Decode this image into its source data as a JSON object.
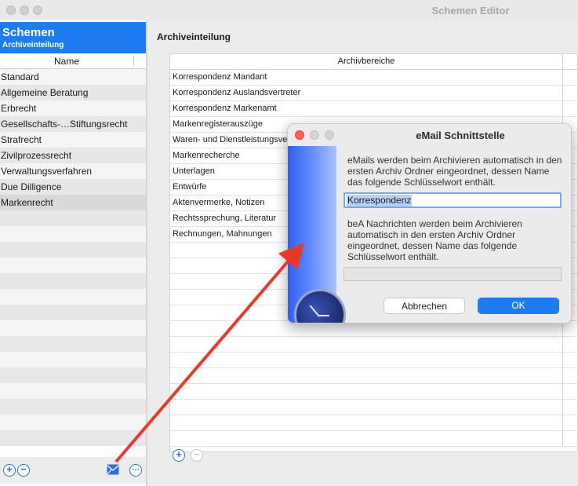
{
  "window": {
    "title": "Schemen Editor"
  },
  "left": {
    "title": "Schemen",
    "subtitle": "Archiveinteilung",
    "column_header": "Name",
    "items": [
      "Standard",
      "Allgemeine Beratung",
      "Erbrecht",
      "Gesellschafts-…Stiftungsrecht",
      "Strafrecht",
      "Zivilprozessrecht",
      "Verwaltungsverfahren",
      "Due Dilligence",
      "Markenrecht"
    ],
    "toolbar": {
      "add": "+",
      "remove": "−",
      "more": "…"
    }
  },
  "right": {
    "title": "Archiveinteilung",
    "column_header": "Archivbereiche",
    "items": [
      "Korrespondenz Mandant",
      "Korrespondenz Auslandsvertreter",
      "Korrespondenz Markenamt",
      "Markenregisterauszüge",
      "Waren- und Dienstleistungsverzeichnis",
      "Markenrecherche",
      "Unterlagen",
      "Entwürfe",
      "Aktenvermerke, Notizen",
      "Rechtssprechung, Literatur",
      "Rechnungen, Mahnungen"
    ],
    "toolbar": {
      "add": "+",
      "remove": "−"
    }
  },
  "dialog": {
    "title": "eMail Schnittstelle",
    "text1": "eMails werden beim Archivieren automatisch in den ersten Archiv Ordner eingeordnet, dessen Name das folgende Schlüsselwort enthält.",
    "email_keyword": "Korrespondenz",
    "text2": "beA Nachrichten werden beim Archivieren automatisch in den ersten Archiv Ordner eingeordnet, dessen Name das folgende Schlüsselwort enthält.",
    "bea_keyword": "",
    "cancel_label": "Abbrechen",
    "ok_label": "OK"
  },
  "colors": {
    "accent": "#1e7cf2",
    "arrow": "#e8392a"
  }
}
